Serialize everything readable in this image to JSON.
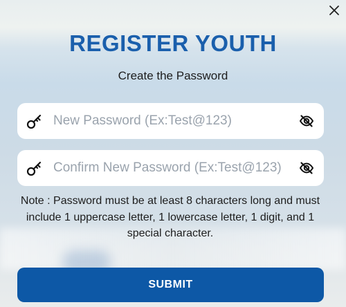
{
  "modal": {
    "title": "REGISTER YOUTH",
    "subtitle": "Create the Password",
    "close_icon": "close-icon"
  },
  "fields": {
    "new_password": {
      "placeholder": "New Password (Ex:Test@123)",
      "value": "",
      "leading_icon": "key-icon",
      "trailing_icon": "eye-slash-icon"
    },
    "confirm_password": {
      "placeholder": "Confirm New Password (Ex:Test@123)",
      "value": "",
      "leading_icon": "key-icon",
      "trailing_icon": "eye-slash-icon"
    }
  },
  "note": "Note : Password must be at least 8 characters long and must include 1 uppercase letter, 1 lowercase letter, 1 digit, and 1 special character.",
  "submit_label": "SUBMIT",
  "colors": {
    "accent": "#1a5fac",
    "button": "#0d58a6",
    "field_bg": "#ffffff"
  }
}
